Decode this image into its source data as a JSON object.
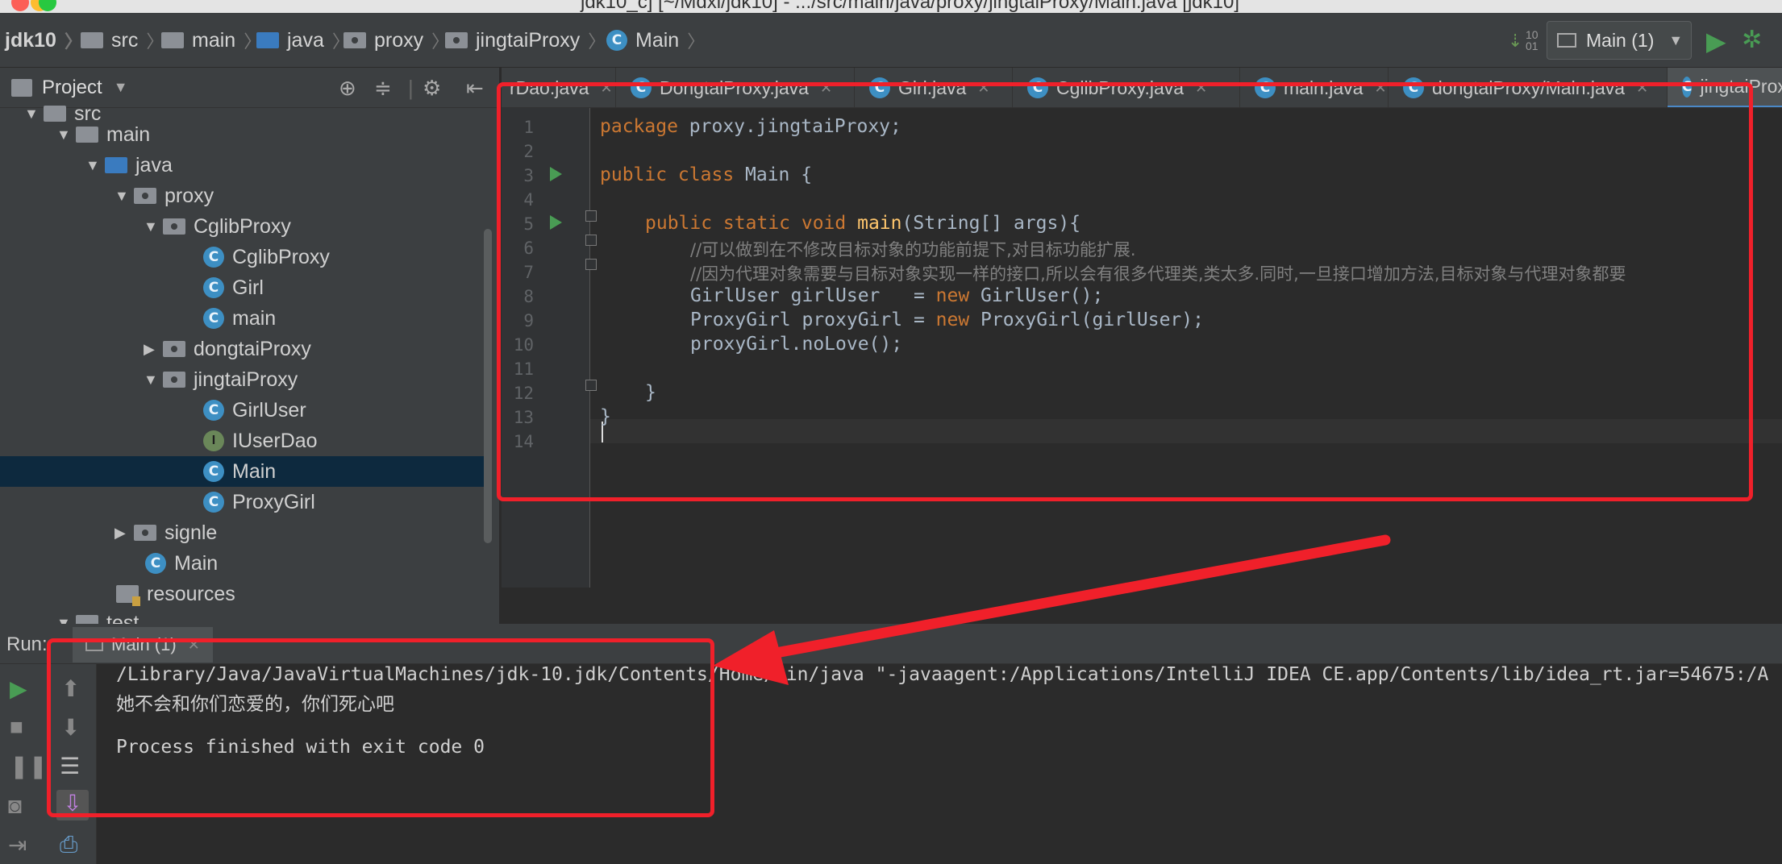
{
  "window": {
    "title": "jdk10_c] [~/Mdxl/jdk10] - .../src/main/java/proxy/jingtaiProxy/Main.java [jdk10]"
  },
  "breadcrumb": {
    "items": [
      "jdk10",
      "src",
      "main",
      "java",
      "proxy",
      "jingtaiProxy",
      "Main"
    ]
  },
  "run_config": {
    "label": "Main (1)"
  },
  "project_panel": {
    "title": "Project",
    "tree": [
      {
        "label": "src",
        "kind": "folder"
      },
      {
        "label": "main",
        "kind": "folder"
      },
      {
        "label": "java",
        "kind": "folder-blue"
      },
      {
        "label": "proxy",
        "kind": "package"
      },
      {
        "label": "CglibProxy",
        "kind": "package"
      },
      {
        "label": "CglibProxy",
        "kind": "class"
      },
      {
        "label": "Girl",
        "kind": "class"
      },
      {
        "label": "main",
        "kind": "class-run"
      },
      {
        "label": "dongtaiProxy",
        "kind": "package"
      },
      {
        "label": "jingtaiProxy",
        "kind": "package"
      },
      {
        "label": "GirlUser",
        "kind": "class"
      },
      {
        "label": "IUserDao",
        "kind": "interface"
      },
      {
        "label": "Main",
        "kind": "class-run",
        "selected": true
      },
      {
        "label": "ProxyGirl",
        "kind": "class"
      },
      {
        "label": "signle",
        "kind": "package"
      },
      {
        "label": "Main",
        "kind": "class-run"
      },
      {
        "label": "resources",
        "kind": "resources"
      },
      {
        "label": "test",
        "kind": "folder"
      }
    ]
  },
  "editor_tabs": [
    "rDao.java",
    "DongtaiProxy.java",
    "Girl.java",
    "CglibProxy.java",
    "main.java",
    "dongtaiProxy/Main.java",
    "jingtaiProxy"
  ],
  "code": {
    "line_numbers": [
      "1",
      "2",
      "3",
      "4",
      "5",
      "6",
      "7",
      "8",
      "9",
      "10",
      "11",
      "12",
      "13",
      "14"
    ],
    "l1_kw": "package",
    "l1_rest": " proxy.jingtaiProxy;",
    "l3_kw": "public class",
    "l3_rest": " Main {",
    "l5_kw": "public static void",
    "l5_fn": "main",
    "l5_rest": "(String[] args){",
    "l6": "//可以做到在不修改目标对象的功能前提下,对目标功能扩展.",
    "l7": "//因为代理对象需要与目标对象实现一样的接口,所以会有很多代理类,类太多.同时,一旦接口增加方法,目标对象与代理对象都要",
    "l8_a": "GirlUser girlUser   = ",
    "l8_kw": "new",
    "l8_b": " GirlUser();",
    "l9_a": "ProxyGirl proxyGirl = ",
    "l9_kw": "new",
    "l9_b": " ProxyGirl(girlUser);",
    "l10": "proxyGirl.noLove();",
    "l12": "}",
    "l13": "}"
  },
  "run_panel": {
    "label": "Run:",
    "tab": "Main (1)",
    "output": [
      "/Library/Java/JavaVirtualMachines/jdk-10.jdk/Contents/Home/bin/java \"-javaagent:/Applications/IntelliJ IDEA CE.app/Contents/lib/idea_rt.jar=54675:/A",
      "她不会和你们恋爱的，你们死心吧",
      "",
      "Process finished with exit code 0"
    ]
  },
  "colors": {
    "annotation": "#f0202a",
    "keyword": "#cc7832",
    "function": "#ffc66d",
    "comment": "#808080"
  }
}
